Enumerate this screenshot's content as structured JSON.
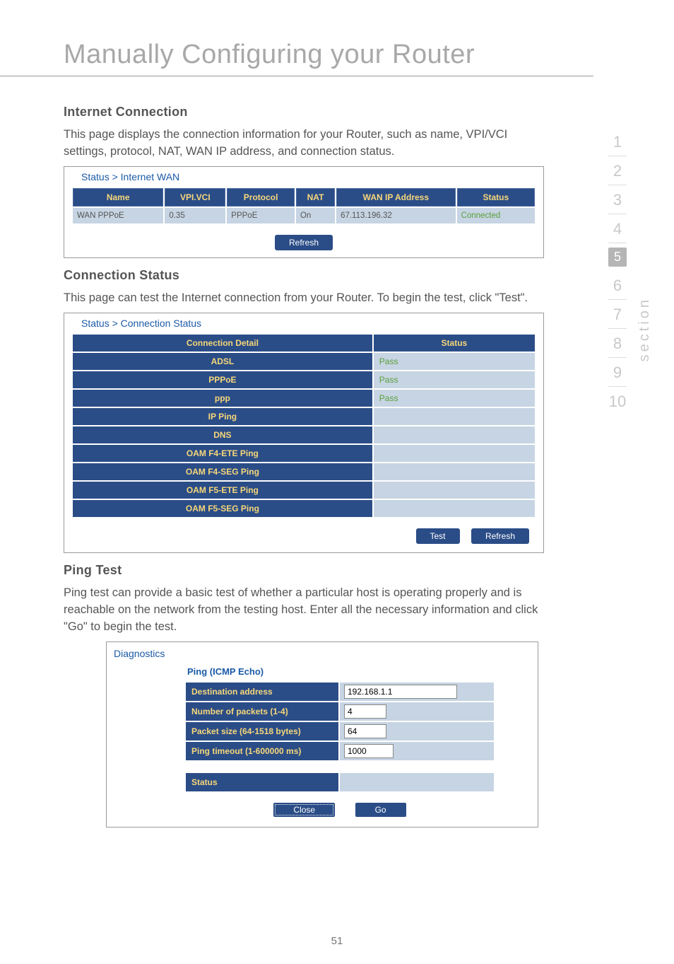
{
  "page": {
    "title": "Manually Configuring your Router",
    "number": "51",
    "side_section_label": "section"
  },
  "nav": {
    "items": [
      "1",
      "2",
      "3",
      "4",
      "5",
      "6",
      "7",
      "8",
      "9",
      "10"
    ],
    "active_index": 4
  },
  "sections": {
    "internet": {
      "heading": "Internet Connection",
      "body": "This page displays the connection information for your Router, such as name, VPI/VCI settings, protocol, NAT, WAN IP address, and connection status.",
      "screenshot": {
        "title": "Status > Internet WAN",
        "headers": [
          "Name",
          "VPI.VCI",
          "Protocol",
          "NAT",
          "WAN IP Address",
          "Status"
        ],
        "row": {
          "name": "WAN PPPoE",
          "vpivci": "0.35",
          "protocol": "PPPoE",
          "nat": "On",
          "wan_ip": "67.113.196.32",
          "status": "Connected"
        },
        "refresh_btn": "Refresh"
      }
    },
    "conn_status": {
      "heading": "Connection Status",
      "body": "This page can test the Internet connection from your Router. To begin the test, click \"Test\".",
      "screenshot": {
        "title": "Status > Connection Status",
        "headers": [
          "Connection Detail",
          "Status"
        ],
        "rows": [
          {
            "label": "ADSL",
            "status": "Pass"
          },
          {
            "label": "PPPoE",
            "status": "Pass"
          },
          {
            "label": "ppp",
            "status": "Pass"
          },
          {
            "label": "IP Ping",
            "status": ""
          },
          {
            "label": "DNS",
            "status": ""
          },
          {
            "label": "OAM F4-ETE Ping",
            "status": ""
          },
          {
            "label": "OAM F4-SEG Ping",
            "status": ""
          },
          {
            "label": "OAM F5-ETE Ping",
            "status": ""
          },
          {
            "label": "OAM F5-SEG Ping",
            "status": ""
          }
        ],
        "test_btn": "Test",
        "refresh_btn": "Refresh"
      }
    },
    "ping": {
      "heading": "Ping Test",
      "body": "Ping test can provide a basic test of whether a particular host is operating properly and is reachable on the network from the testing host. Enter all the necessary information and click \"Go\" to begin the test.",
      "screenshot": {
        "title": "Diagnostics",
        "subhead": "Ping (ICMP Echo)",
        "fields": {
          "dest_label": "Destination address",
          "dest_value": "192.168.1.1",
          "num_label": "Number of packets (1-4)",
          "num_value": "4",
          "size_label": "Packet size (64-1518 bytes)",
          "size_value": "64",
          "timeout_label": "Ping timeout (1-600000 ms)",
          "timeout_value": "1000"
        },
        "status_label": "Status",
        "close_btn": "Close",
        "go_btn": "Go"
      }
    }
  }
}
